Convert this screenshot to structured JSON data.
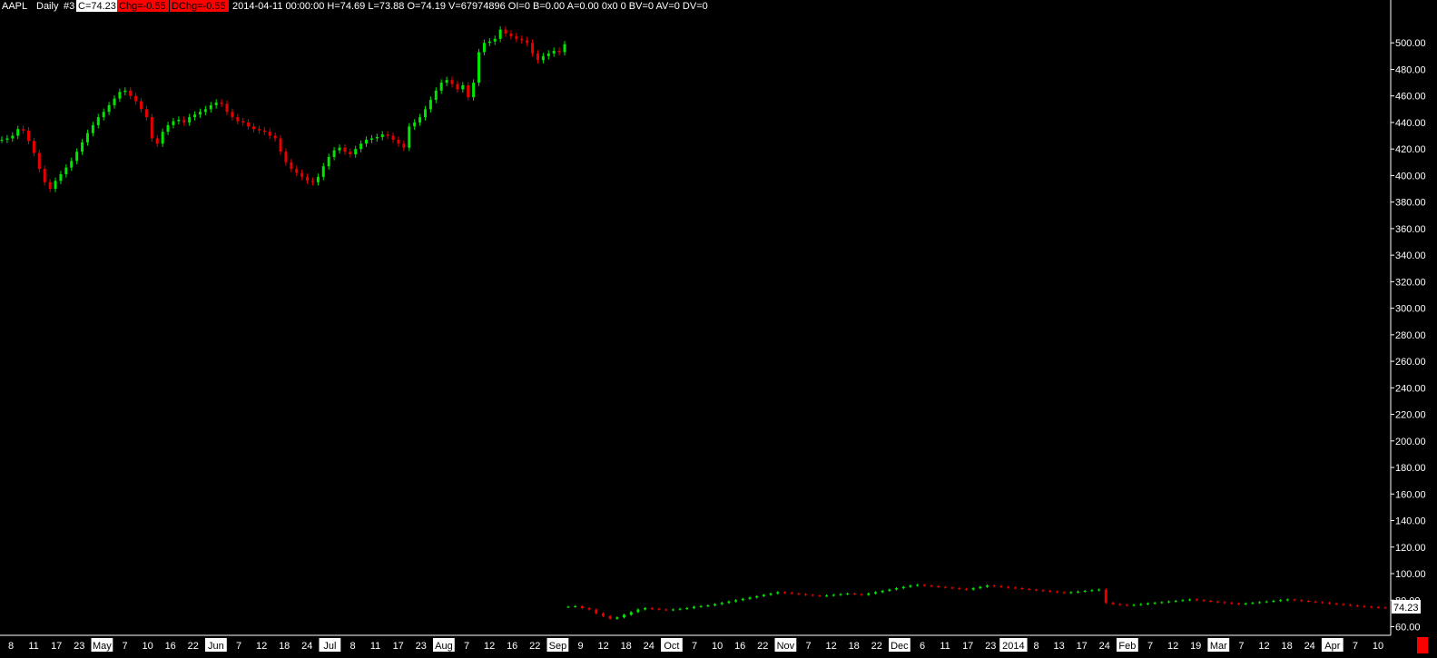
{
  "header": {
    "symbol": "AAPL",
    "interval": "Daily",
    "chart_id": "#3",
    "close_label": "C=74.23",
    "chg_label": "Chg=-0.55",
    "dchg_label": "DChg=-0.55",
    "info": "2014-04-11 00:00:00 H=74.69 L=73.88 O=74.19 V=67974896 OI=0 B=0.00 A=0.00 0x0 0 BV=0 AV=0 DV=0"
  },
  "colors": {
    "up": "#00e600",
    "down": "#e60000",
    "background": "#000000",
    "axis": "#ffffff",
    "last_price_marker": "#ff0000"
  },
  "chart_data": {
    "type": "candlestick",
    "symbol": "AAPL",
    "ylim": [
      55,
      525
    ],
    "y_ticks": [
      "60.00",
      "80.00",
      "100.00",
      "120.00",
      "140.00",
      "160.00",
      "180.00",
      "200.00",
      "220.00",
      "240.00",
      "260.00",
      "280.00",
      "300.00",
      "320.00",
      "340.00",
      "360.00",
      "380.00",
      "400.00",
      "420.00",
      "440.00",
      "460.00",
      "480.00",
      "500.00"
    ],
    "last_price_label": "74.23",
    "x_labels": [
      {
        "text": "8",
        "boxed": false
      },
      {
        "text": "11",
        "boxed": false
      },
      {
        "text": "17",
        "boxed": false
      },
      {
        "text": "23",
        "boxed": false
      },
      {
        "text": "May",
        "boxed": true
      },
      {
        "text": "7",
        "boxed": false
      },
      {
        "text": "10",
        "boxed": false
      },
      {
        "text": "16",
        "boxed": false
      },
      {
        "text": "22",
        "boxed": false
      },
      {
        "text": "Jun",
        "boxed": true
      },
      {
        "text": "7",
        "boxed": false
      },
      {
        "text": "12",
        "boxed": false
      },
      {
        "text": "18",
        "boxed": false
      },
      {
        "text": "24",
        "boxed": false
      },
      {
        "text": "Jul",
        "boxed": true
      },
      {
        "text": "8",
        "boxed": false
      },
      {
        "text": "11",
        "boxed": false
      },
      {
        "text": "17",
        "boxed": false
      },
      {
        "text": "23",
        "boxed": false
      },
      {
        "text": "Aug",
        "boxed": true
      },
      {
        "text": "7",
        "boxed": false
      },
      {
        "text": "12",
        "boxed": false
      },
      {
        "text": "16",
        "boxed": false
      },
      {
        "text": "22",
        "boxed": false
      },
      {
        "text": "Sep",
        "boxed": true
      },
      {
        "text": "9",
        "boxed": false
      },
      {
        "text": "12",
        "boxed": false
      },
      {
        "text": "18",
        "boxed": false
      },
      {
        "text": "24",
        "boxed": false
      },
      {
        "text": "Oct",
        "boxed": true
      },
      {
        "text": "7",
        "boxed": false
      },
      {
        "text": "10",
        "boxed": false
      },
      {
        "text": "16",
        "boxed": false
      },
      {
        "text": "22",
        "boxed": false
      },
      {
        "text": "Nov",
        "boxed": true
      },
      {
        "text": "7",
        "boxed": false
      },
      {
        "text": "12",
        "boxed": false
      },
      {
        "text": "18",
        "boxed": false
      },
      {
        "text": "22",
        "boxed": false
      },
      {
        "text": "Dec",
        "boxed": true
      },
      {
        "text": "6",
        "boxed": false
      },
      {
        "text": "11",
        "boxed": false
      },
      {
        "text": "17",
        "boxed": false
      },
      {
        "text": "23",
        "boxed": false
      },
      {
        "text": "2014",
        "boxed": true
      },
      {
        "text": "8",
        "boxed": false
      },
      {
        "text": "13",
        "boxed": false
      },
      {
        "text": "17",
        "boxed": false
      },
      {
        "text": "24",
        "boxed": false
      },
      {
        "text": "Feb",
        "boxed": true
      },
      {
        "text": "7",
        "boxed": false
      },
      {
        "text": "12",
        "boxed": false
      },
      {
        "text": "19",
        "boxed": false
      },
      {
        "text": "Mar",
        "boxed": true
      },
      {
        "text": "7",
        "boxed": false
      },
      {
        "text": "12",
        "boxed": false
      },
      {
        "text": "18",
        "boxed": false
      },
      {
        "text": "24",
        "boxed": false
      },
      {
        "text": "Apr",
        "boxed": true
      },
      {
        "text": "7",
        "boxed": false
      },
      {
        "text": "10",
        "boxed": false
      }
    ],
    "segment1_closes": [
      427,
      428,
      430,
      435,
      434,
      426,
      417,
      405,
      395,
      390,
      396,
      401,
      406,
      411,
      418,
      425,
      432,
      438,
      444,
      448,
      453,
      458,
      463,
      464,
      460,
      456,
      450,
      444,
      428,
      424,
      433,
      438,
      441,
      442,
      440,
      444,
      446,
      448,
      450,
      453,
      455,
      454,
      448,
      444,
      441,
      440,
      437,
      435,
      434,
      433,
      430,
      428,
      418,
      410,
      405,
      402,
      399,
      396,
      395,
      399,
      407,
      414,
      419,
      421,
      418,
      416,
      420,
      424,
      427,
      428,
      429,
      431,
      430,
      427,
      424,
      421,
      437,
      440,
      444,
      450,
      457,
      464,
      470,
      472,
      469,
      465,
      468,
      459,
      470,
      493,
      500,
      501,
      503,
      510,
      507,
      505,
      503,
      502,
      500,
      492,
      487,
      490,
      492,
      494,
      493,
      499
    ],
    "segment2_closes": [
      75,
      75.5,
      74,
      73,
      70,
      68,
      66,
      67,
      69,
      71,
      73,
      74,
      73.5,
      73,
      72.5,
      73,
      73.5,
      74,
      75,
      75.5,
      76,
      77,
      78,
      79,
      80,
      81,
      82,
      83,
      84,
      85,
      86,
      85.5,
      85,
      84.5,
      84,
      83.5,
      83,
      83.5,
      84,
      84.5,
      85,
      84.5,
      84,
      85,
      86,
      87,
      88,
      89,
      90,
      91,
      91.5,
      91,
      90.5,
      90,
      89.5,
      89,
      88.5,
      88,
      89,
      90,
      91,
      90.5,
      90,
      89.5,
      89,
      88.5,
      88,
      87.5,
      87,
      86.5,
      86,
      85.5,
      86,
      86.5,
      87,
      87.5,
      88,
      78,
      77,
      76.5,
      76,
      76.5,
      77,
      77.5,
      78,
      78.5,
      79,
      79.5,
      80,
      80.5,
      80,
      79.5,
      79,
      78.5,
      78,
      77.5,
      77,
      77.5,
      78,
      78.5,
      79,
      79.5,
      80,
      80.5,
      80,
      79.5,
      79,
      78.5,
      78,
      77.5,
      77,
      76.5,
      76,
      75.5,
      75,
      74.7,
      74.4,
      74.23
    ]
  }
}
